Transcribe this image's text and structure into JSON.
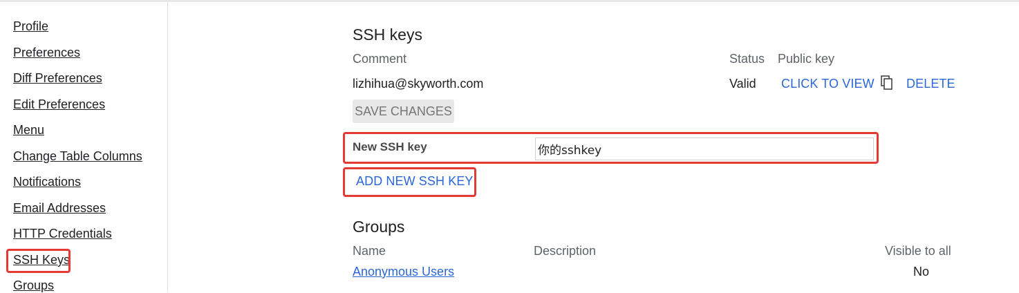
{
  "sidebar": {
    "items": [
      {
        "label": "Profile"
      },
      {
        "label": "Preferences"
      },
      {
        "label": "Diff Preferences"
      },
      {
        "label": "Edit Preferences"
      },
      {
        "label": "Menu"
      },
      {
        "label": "Change Table Columns"
      },
      {
        "label": "Notifications"
      },
      {
        "label": "Email Addresses"
      },
      {
        "label": "HTTP Credentials"
      },
      {
        "label": "SSH Keys"
      },
      {
        "label": "Groups"
      }
    ]
  },
  "ssh": {
    "title": "SSH keys",
    "columns": {
      "comment": "Comment",
      "status": "Status",
      "public_key": "Public key"
    },
    "keys": [
      {
        "comment": "lizhihua@skyworth.com",
        "status": "Valid",
        "view_label": "CLICK TO VIEW",
        "copy_icon": "copy-icon",
        "delete_label": "DELETE"
      }
    ],
    "save_label": "SAVE CHANGES",
    "new_key_label": "New SSH key",
    "new_key_value": "你的sshkey",
    "add_label": "ADD NEW SSH KEY"
  },
  "groups": {
    "title": "Groups",
    "columns": {
      "name": "Name",
      "description": "Description",
      "visible": "Visible to all"
    },
    "rows": [
      {
        "name": "Anonymous Users",
        "visible": "No"
      }
    ]
  },
  "annotations": {
    "highlight_color": "#e53935"
  }
}
